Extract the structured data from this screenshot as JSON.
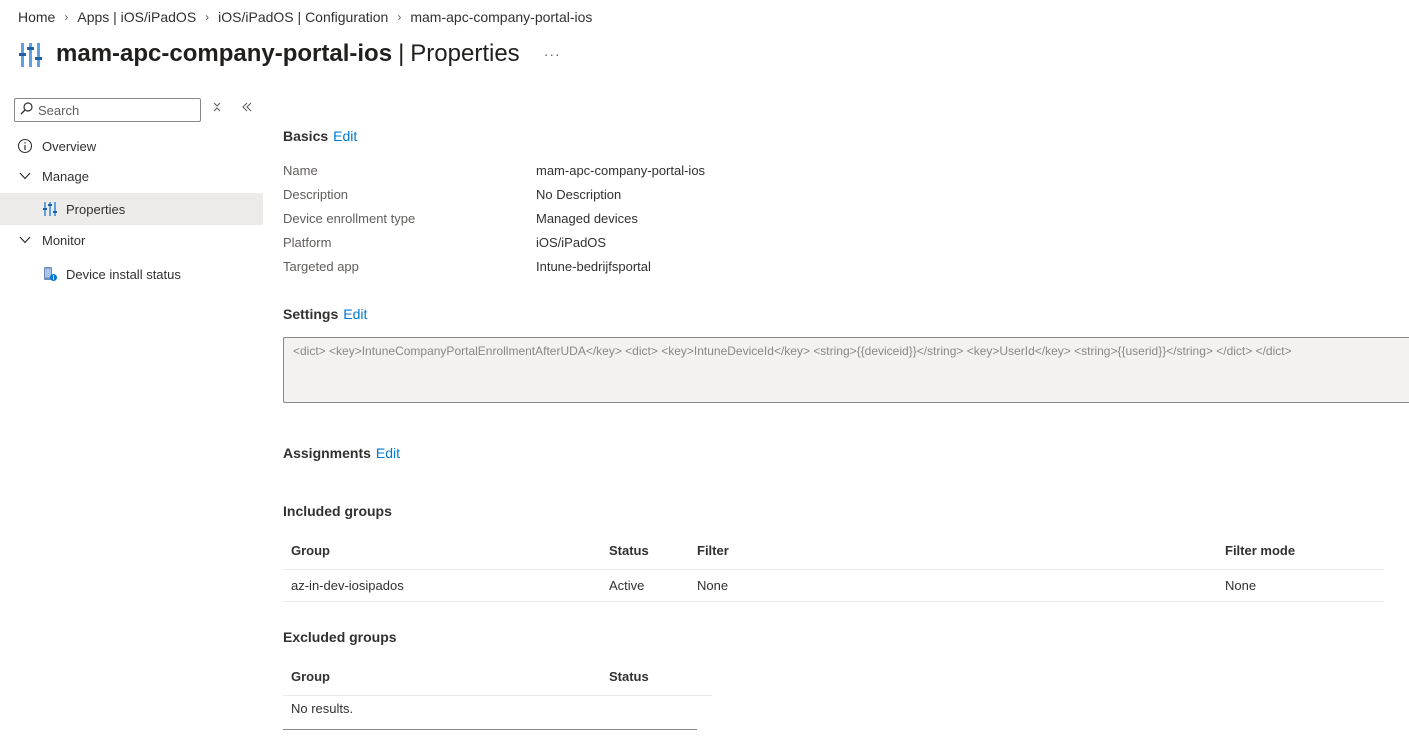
{
  "breadcrumb": {
    "items": [
      "Home",
      "Apps | iOS/iPadOS",
      "iOS/iPadOS | Configuration",
      "mam-apc-company-portal-ios"
    ]
  },
  "header": {
    "resource_name": "mam-apc-company-portal-ios",
    "separator": "|",
    "page_name": "Properties",
    "more_label": "···",
    "icon": "properties-sliders-icon"
  },
  "sidebar": {
    "search_placeholder": "Search",
    "items": [
      {
        "label": "Overview",
        "icon": "info-icon"
      },
      {
        "label": "Manage",
        "icon": "chevron-down-icon"
      },
      {
        "label": "Properties",
        "icon": "properties-icon"
      },
      {
        "label": "Monitor",
        "icon": "chevron-down-icon"
      },
      {
        "label": "Device install status",
        "icon": "device-status-icon"
      }
    ]
  },
  "basics": {
    "title": "Basics",
    "edit": "Edit",
    "rows": [
      {
        "label": "Name",
        "value": "mam-apc-company-portal-ios"
      },
      {
        "label": "Description",
        "value": "No Description"
      },
      {
        "label": "Device enrollment type",
        "value": "Managed devices"
      },
      {
        "label": "Platform",
        "value": "iOS/iPadOS"
      },
      {
        "label": "Targeted app",
        "value": "Intune-bedrijfsportal"
      }
    ]
  },
  "settings": {
    "title": "Settings",
    "edit": "Edit",
    "xml": "<dict> <key>IntuneCompanyPortalEnrollmentAfterUDA</key> <dict> <key>IntuneDeviceId</key> <string>{{deviceid}}</string> <key>UserId</key> <string>{{userid}}</string> </dict> </dict>"
  },
  "assignments": {
    "title": "Assignments",
    "edit": "Edit",
    "included": {
      "title": "Included groups",
      "headers": [
        "Group",
        "Status",
        "Filter",
        "Filter mode"
      ],
      "rows": [
        [
          "az-in-dev-iosipados",
          "Active",
          "None",
          "None"
        ]
      ]
    },
    "excluded": {
      "title": "Excluded groups",
      "headers": [
        "Group",
        "Status"
      ],
      "empty": "No results."
    }
  },
  "colors": {
    "accent": "#0078d4",
    "active_nav": "#edebe9",
    "text": "#323130"
  }
}
